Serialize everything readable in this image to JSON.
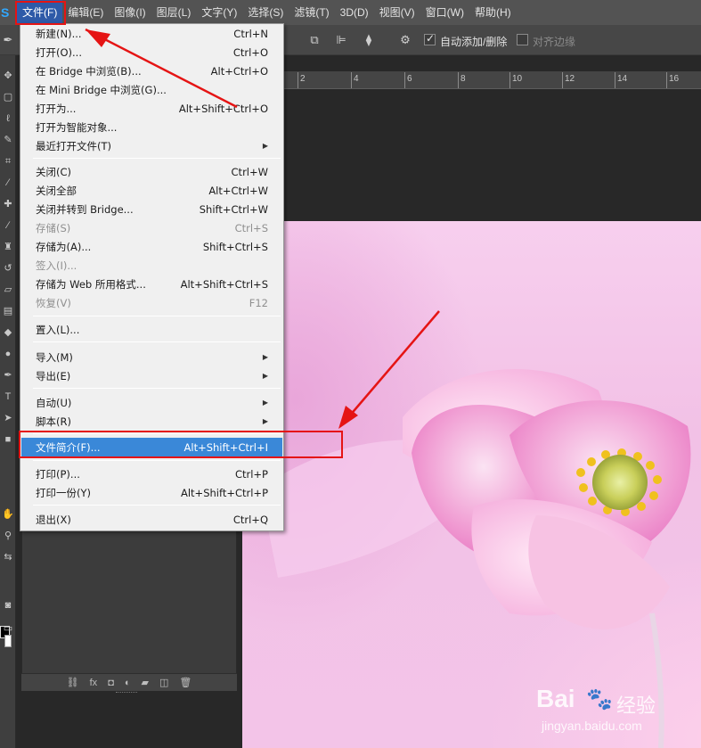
{
  "menubar": {
    "logo": "S",
    "items": [
      {
        "label": "文件(F)",
        "active": true
      },
      {
        "label": "编辑(E)"
      },
      {
        "label": "图像(I)"
      },
      {
        "label": "图层(L)"
      },
      {
        "label": "文字(Y)"
      },
      {
        "label": "选择(S)"
      },
      {
        "label": "滤镜(T)"
      },
      {
        "label": "3D(D)"
      },
      {
        "label": "视图(V)"
      },
      {
        "label": "窗口(W)"
      },
      {
        "label": "帮助(H)"
      }
    ]
  },
  "options_bar": {
    "auto_add_delete": {
      "label": "自动添加/删除",
      "checked": true
    },
    "align_edges": {
      "label": "对齐边缘",
      "checked": false
    }
  },
  "ruler": {
    "labels": [
      "2",
      "4",
      "6",
      "8",
      "10",
      "12",
      "14",
      "16"
    ]
  },
  "file_menu": {
    "items": [
      {
        "label": "新建(N)...",
        "shortcut": "Ctrl+N"
      },
      {
        "label": "打开(O)...",
        "shortcut": "Ctrl+O"
      },
      {
        "label": "在 Bridge 中浏览(B)...",
        "shortcut": "Alt+Ctrl+O"
      },
      {
        "label": "在 Mini Bridge 中浏览(G)...",
        "shortcut": ""
      },
      {
        "label": "打开为...",
        "shortcut": "Alt+Shift+Ctrl+O"
      },
      {
        "label": "打开为智能对象...",
        "shortcut": ""
      },
      {
        "label": "最近打开文件(T)",
        "shortcut": "",
        "submenu": true
      },
      {
        "label": "关闭(C)",
        "shortcut": "Ctrl+W"
      },
      {
        "label": "关闭全部",
        "shortcut": "Alt+Ctrl+W"
      },
      {
        "label": "关闭并转到 Bridge...",
        "shortcut": "Shift+Ctrl+W"
      },
      {
        "label": "存储(S)",
        "shortcut": "Ctrl+S",
        "disabled": true
      },
      {
        "label": "存储为(A)...",
        "shortcut": "Shift+Ctrl+S"
      },
      {
        "label": "签入(I)...",
        "shortcut": "",
        "disabled": true
      },
      {
        "label": "存储为 Web 所用格式...",
        "shortcut": "Alt+Shift+Ctrl+S"
      },
      {
        "label": "恢复(V)",
        "shortcut": "F12",
        "disabled": true
      },
      {
        "label": "置入(L)...",
        "shortcut": ""
      },
      {
        "label": "导入(M)",
        "shortcut": "",
        "submenu": true
      },
      {
        "label": "导出(E)",
        "shortcut": "",
        "submenu": true
      },
      {
        "label": "自动(U)",
        "shortcut": "",
        "submenu": true
      },
      {
        "label": "脚本(R)",
        "shortcut": "",
        "submenu": true
      },
      {
        "label": "文件简介(F)...",
        "shortcut": "Alt+Shift+Ctrl+I",
        "highlighted": true
      },
      {
        "label": "打印(P)...",
        "shortcut": "Ctrl+P"
      },
      {
        "label": "打印一份(Y)",
        "shortcut": "Alt+Shift+Ctrl+P"
      },
      {
        "label": "退出(X)",
        "shortcut": "Ctrl+Q"
      }
    ]
  },
  "watermark": {
    "brand_left": "Bai",
    "brand_right": "经验",
    "url": "jingyan.baidu.com"
  },
  "colors": {
    "annotation": "#e51414",
    "menu_highlight": "#3a88d8",
    "menubar": "#535353"
  }
}
